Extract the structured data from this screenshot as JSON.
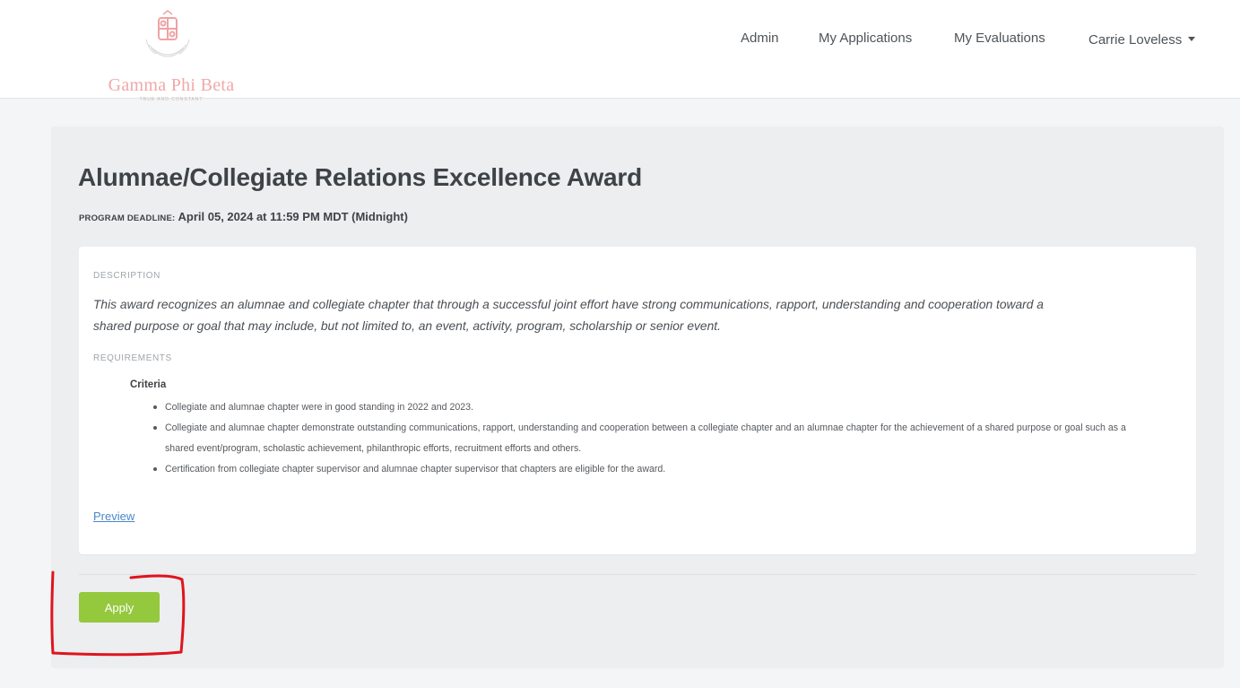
{
  "header": {
    "logo": {
      "name": "Gamma Phi Beta",
      "motto": "TRUE AND CONSTANT",
      "crest_color": "#f0a9a9"
    },
    "nav": {
      "admin": "Admin",
      "my_applications": "My Applications",
      "my_evaluations": "My Evaluations",
      "user_name": "Carrie Loveless",
      "user_menu_icon": "caret-down-icon"
    }
  },
  "program": {
    "title": "Alumnae/Collegiate Relations Excellence Award",
    "deadline_label": "PROGRAM DEADLINE:",
    "deadline_value": "April 05, 2024 at 11:59 PM MDT (Midnight)",
    "description_label": "DESCRIPTION",
    "description_line1": "This award recognizes an alumnae and collegiate chapter that through a successful joint effort have strong communications, rapport, understanding and cooperation toward a",
    "description_line2": "shared purpose or goal that may include, but not limited to, an event, activity, program, scholarship or senior event.",
    "requirements_label": "REQUIREMENTS",
    "criteria_heading": "Criteria",
    "criteria": [
      "Collegiate and alumnae chapter were in good standing in 2022 and 2023.",
      "Collegiate and alumnae chapter demonstrate outstanding communications, rapport, understanding and cooperation between a collegiate chapter and an alumnae chapter for the achievement of a shared purpose or goal such as a shared event/program, scholastic achievement, philanthropic efforts, recruitment efforts and others.",
      "Certification from collegiate chapter supervisor and alumnae chapter supervisor that chapters are eligible for the award."
    ],
    "preview_link": "Preview",
    "apply_button": "Apply"
  },
  "colors": {
    "accent_green": "#94c83d",
    "link_blue": "#4a88c7",
    "annotation_red": "#e0141e",
    "logo_pink": "#f0a9a9"
  }
}
